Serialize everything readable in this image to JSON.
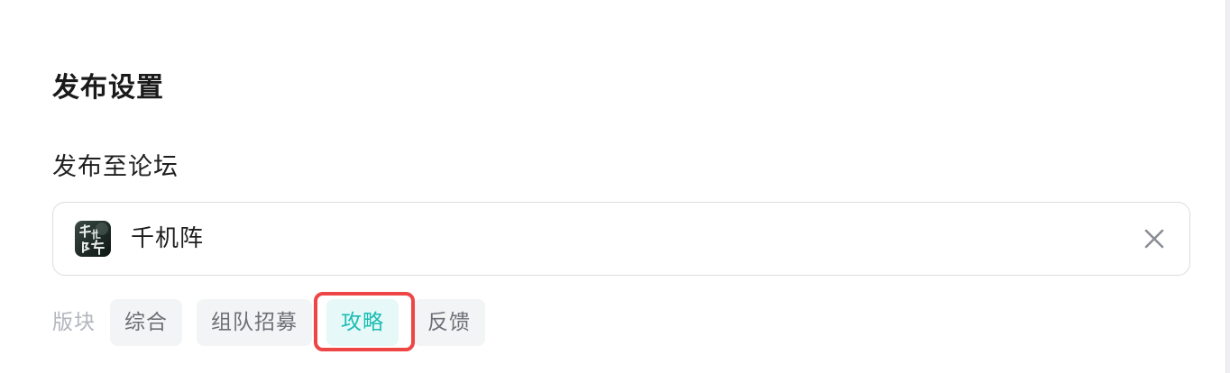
{
  "publish_settings": {
    "title": "发布设置",
    "target_label": "发布至论坛",
    "forum": {
      "name": "千机阵",
      "logo_icon": "game-logo",
      "clear_icon": "close-icon"
    },
    "board": {
      "label": "版块",
      "options": [
        "综合",
        "组队招募",
        "攻略",
        "反馈"
      ],
      "selected": "攻略"
    }
  },
  "colors": {
    "accent": "#19bdb3",
    "accent_bg": "#e6f8f7",
    "chip_bg": "#f3f4f6",
    "highlight": "#ee4545"
  }
}
